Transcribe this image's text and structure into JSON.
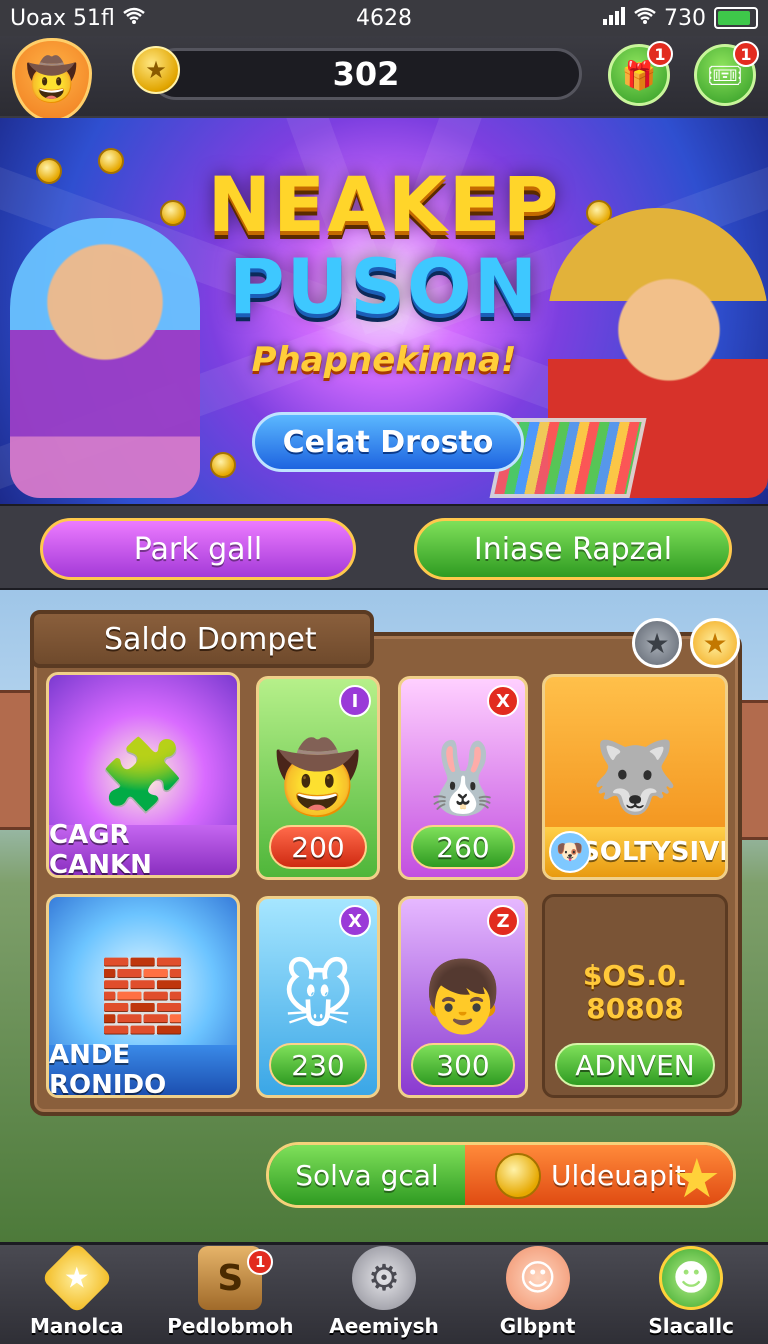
{
  "status_bar": {
    "left_text": "Uoax 51fl",
    "time": "4628",
    "battery_text": "730",
    "battery_level": 0.9
  },
  "hud": {
    "coins": "302",
    "avatar_icon": "cowboy-avatar-icon",
    "right_buttons": [
      {
        "icon": "gift-box-icon",
        "badge": "1"
      },
      {
        "icon": "ticket-icon",
        "badge": "1"
      }
    ]
  },
  "banner": {
    "title_line1": "NEAKEP",
    "title_line2": "PUSON",
    "subtitle": "Phapnekinna!",
    "cta_label": "Celat Drosto"
  },
  "actions": {
    "left_label": "Park gall",
    "right_label": "Iniase Rapzal"
  },
  "wallet": {
    "title": "Saldo Dompet",
    "cards": [
      {
        "label": "CAGR CANKN",
        "badge": "",
        "icon": "puzzle-pieces-icon"
      },
      {
        "label": "200",
        "badge": "I",
        "icon": "cowboy-boy-icon"
      },
      {
        "label": "260",
        "badge": "X",
        "icon": "bunny-girl-icon"
      },
      {
        "label": "SOLTYSIVI",
        "badge": "",
        "icon": "wolf-character-icon"
      },
      {
        "label": "ANDE RONIDO",
        "badge": "",
        "icon": "blocks-icon"
      },
      {
        "label": "230",
        "badge": "X",
        "icon": "bunny-mouse-icon"
      },
      {
        "label": "300",
        "badge": "Z",
        "icon": "boy-character-icon"
      },
      {
        "label": "ADNVEN",
        "badge": "",
        "icon": "price-icon"
      }
    ],
    "price_text": "$OS.0. 80808"
  },
  "bottom_action": {
    "left_label": "Solva gcal",
    "right_label": "Uldeuapit"
  },
  "bottom_nav": {
    "items": [
      {
        "label": "Manolca",
        "icon": "star-trophy-icon",
        "badge": ""
      },
      {
        "label": "Pedlobmoh",
        "icon": "crate-icon",
        "badge": "1"
      },
      {
        "label": "Aeemiysh",
        "icon": "gear-coin-icon",
        "badge": ""
      },
      {
        "label": "Glbpnt",
        "icon": "sun-face-icon",
        "badge": ""
      },
      {
        "label": "Slacallc",
        "icon": "smiley-icon",
        "badge": ""
      }
    ]
  },
  "colors": {
    "accent_green": "#2f9b22",
    "accent_purple": "#a43ad8",
    "accent_orange": "#e04b12",
    "gold": "#ffd52a"
  }
}
